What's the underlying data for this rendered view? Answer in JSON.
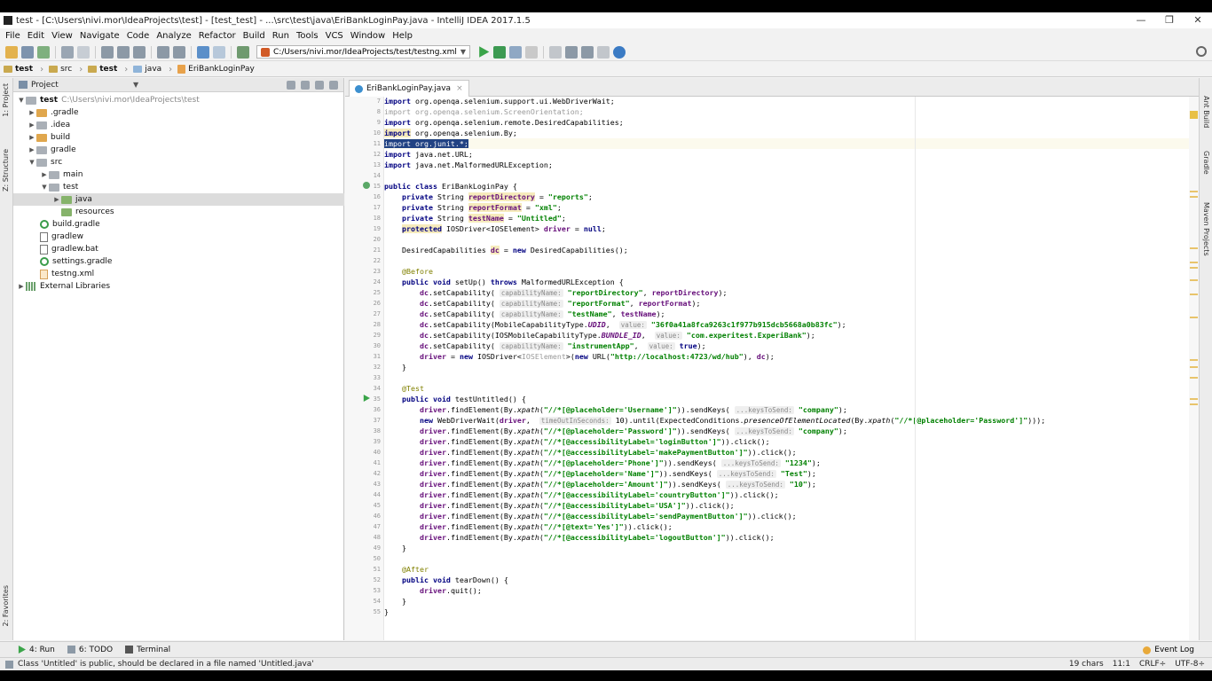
{
  "window": {
    "title": "test - [C:\\Users\\nivi.mor\\IdeaProjects\\test] - [test_test] - ...\\src\\test\\java\\EriBankLoginPay.java - IntelliJ IDEA 2017.1.5",
    "minimize": "—",
    "restore": "❐",
    "close": "✕"
  },
  "menu": [
    "File",
    "Edit",
    "View",
    "Navigate",
    "Code",
    "Analyze",
    "Refactor",
    "Build",
    "Run",
    "Tools",
    "VCS",
    "Window",
    "Help"
  ],
  "toolbar": {
    "run_config": "C:/Users/nivi.mor/IdeaProjects/test/testng.xml"
  },
  "breadcrumbs": [
    "test",
    "src",
    "test",
    "java",
    "EriBankLoginPay"
  ],
  "left_strip": {
    "project_tab": "1: Project",
    "structure_tab": "Z: Structure",
    "favorites_tab": "2: Favorites"
  },
  "project_panel": {
    "title": "Project",
    "tree": [
      {
        "label": "test",
        "path": "C:\\Users\\nivi.mor\\IdeaProjects\\test"
      },
      {
        "label": ".gradle"
      },
      {
        "label": ".idea"
      },
      {
        "label": "build"
      },
      {
        "label": "gradle"
      },
      {
        "label": "src"
      },
      {
        "label": "main"
      },
      {
        "label": "test"
      },
      {
        "label": "java"
      },
      {
        "label": "resources"
      },
      {
        "label": "build.gradle"
      },
      {
        "label": "gradlew"
      },
      {
        "label": "gradlew.bat"
      },
      {
        "label": "settings.gradle"
      },
      {
        "label": "testng.xml"
      },
      {
        "label": "External Libraries"
      }
    ]
  },
  "editor": {
    "tab_label": "EriBankLoginPay.java",
    "tab_close": "×",
    "line_numbers": [
      "7",
      "8",
      "9",
      "10",
      "11",
      "12",
      "13",
      "14",
      "15",
      "16",
      "17",
      "18",
      "19",
      "20",
      "21",
      "22",
      "23",
      "24",
      "25",
      "26",
      "27",
      "28",
      "29",
      "30",
      "31",
      "32",
      "33",
      "34",
      "35",
      "36",
      "37",
      "38",
      "39",
      "40",
      "41",
      "42",
      "43",
      "44",
      "45",
      "46",
      "47",
      "48",
      "49",
      "50",
      "51",
      "52",
      "53",
      "54",
      "55"
    ]
  },
  "right_strip": {
    "ant": "Ant Build",
    "gradle": "Gradle",
    "maven": "Maven Projects"
  },
  "bottom_tools": {
    "run": "4: Run",
    "todo": "6: TODO",
    "terminal": "Terminal",
    "event_log": "Event Log"
  },
  "status": {
    "message": "Class 'Untitled' is public, should be declared in a file named 'Untitled.java'",
    "chars": "19 chars",
    "position": "11:1",
    "line_sep": "CRLF÷",
    "encoding": "UTF-8÷"
  },
  "colors": {
    "keyword": "#000080",
    "string": "#008000",
    "field": "#660e7a",
    "annotation": "#808000",
    "selection": "#214283"
  }
}
